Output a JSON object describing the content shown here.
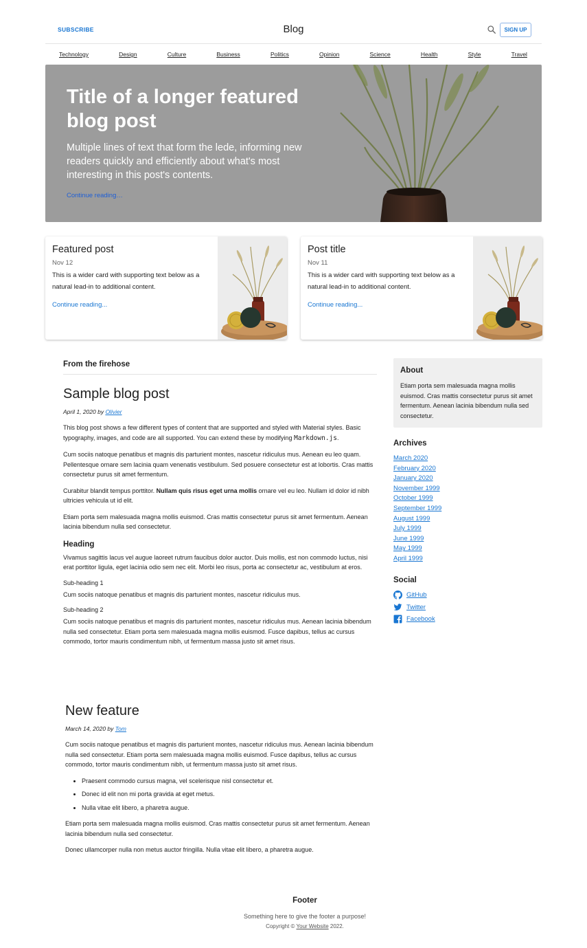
{
  "header": {
    "subscribe_label": "SUBSCRIBE",
    "title": "Blog",
    "search_icon": "search-icon",
    "signup_label": "SIGN UP"
  },
  "nav": [
    "Technology",
    "Design",
    "Culture",
    "Business",
    "Politics",
    "Opinion",
    "Science",
    "Health",
    "Style",
    "Travel"
  ],
  "hero": {
    "title": "Title of a longer featured blog post",
    "lede": "Multiple lines of text that form the lede, informing new readers quickly and efficiently about what's most interesting in this post's contents.",
    "link": "Continue reading…"
  },
  "cards": [
    {
      "title": "Featured post",
      "date": "Nov 12",
      "text": "This is a wider card with supporting text below as a natural lead-in to additional content.",
      "link": "Continue reading..."
    },
    {
      "title": "Post title",
      "date": "Nov 11",
      "text": "This is a wider card with supporting text below as a natural lead-in to additional content.",
      "link": "Continue reading..."
    }
  ],
  "main": {
    "section_title": "From the firehose",
    "post1": {
      "title": "Sample blog post",
      "meta_prefix": "April 1, 2020 by ",
      "author": "Olivier",
      "p1_text": "This blog post shows a few different types of content that are supported and styled with Material styles. Basic typography, images, and code are all supported. You can extend these by modifying ",
      "p1_code": "Markdown.js",
      "p1_end": ".",
      "p2": "Cum sociis natoque penatibus et magnis dis parturient montes, nascetur ridiculus mus. Aenean eu leo quam. Pellentesque ornare sem lacinia quam venenatis vestibulum. Sed posuere consectetur est at lobortis. Cras mattis consectetur purus sit amet fermentum.",
      "p3_start": "Curabitur blandit tempus porttitor. ",
      "p3_bold": "Nullam quis risus eget urna mollis",
      "p3_end": " ornare vel eu leo. Nullam id dolor id nibh ultricies vehicula ut id elit.",
      "p4": "Etiam porta sem malesuada magna mollis euismod. Cras mattis consectetur purus sit amet fermentum. Aenean lacinia bibendum nulla sed consectetur.",
      "heading": "Heading",
      "p5": "Vivamus sagittis lacus vel augue laoreet rutrum faucibus dolor auctor. Duis mollis, est non commodo luctus, nisi erat porttitor ligula, eget lacinia odio sem nec elit. Morbi leo risus, porta ac consectetur ac, vestibulum at eros.",
      "sub1": "Sub-heading 1",
      "p6": "Cum sociis natoque penatibus et magnis dis parturient montes, nascetur ridiculus mus.",
      "sub2": "Sub-heading 2",
      "p7": "Cum sociis natoque penatibus et magnis dis parturient montes, nascetur ridiculus mus. Aenean lacinia bibendum nulla sed consectetur. Etiam porta sem malesuada magna mollis euismod. Fusce dapibus, tellus ac cursus commodo, tortor mauris condimentum nibh, ut fermentum massa justo sit amet risus."
    },
    "post2": {
      "title": "New feature",
      "meta_prefix": "March 14, 2020 by ",
      "author": "Tom",
      "p1": "Cum sociis natoque penatibus et magnis dis parturient montes, nascetur ridiculus mus. Aenean lacinia bibendum nulla sed consectetur. Etiam porta sem malesuada magna mollis euismod. Fusce dapibus, tellus ac cursus commodo, tortor mauris condimentum nibh, ut fermentum massa justo sit amet risus.",
      "list": [
        "Praesent commodo cursus magna, vel scelerisque nisl consectetur et.",
        "Donec id elit non mi porta gravida at eget metus.",
        "Nulla vitae elit libero, a pharetra augue."
      ],
      "p2": "Etiam porta sem malesuada magna mollis euismod. Cras mattis consectetur purus sit amet fermentum. Aenean lacinia bibendum nulla sed consectetur.",
      "p3": "Donec ullamcorper nulla non metus auctor fringilla. Nulla vitae elit libero, a pharetra augue."
    }
  },
  "sidebar": {
    "about_title": "About",
    "about_text": "Etiam porta sem malesuada magna mollis euismod. Cras mattis consectetur purus sit amet fermentum. Aenean lacinia bibendum nulla sed consectetur.",
    "archives_title": "Archives",
    "archives": [
      "March 2020",
      "February 2020",
      "January 2020",
      "November 1999",
      "October 1999",
      "September 1999",
      "August 1999",
      "July 1999",
      "June 1999",
      "May 1999",
      "April 1999"
    ],
    "social_title": "Social",
    "social": [
      {
        "label": "GitHub",
        "icon": "github-icon"
      },
      {
        "label": "Twitter",
        "icon": "twitter-icon"
      },
      {
        "label": "Facebook",
        "icon": "facebook-icon"
      }
    ]
  },
  "footer": {
    "title": "Footer",
    "subtitle": "Something here to give the footer a purpose!",
    "copy_prefix": "Copyright © ",
    "copy_link": "Your Website",
    "copy_suffix": " 2022."
  },
  "colors": {
    "accent": "#1976d2",
    "hero_bg": "#9c9c9c",
    "sidebar_bg": "#efefef"
  }
}
